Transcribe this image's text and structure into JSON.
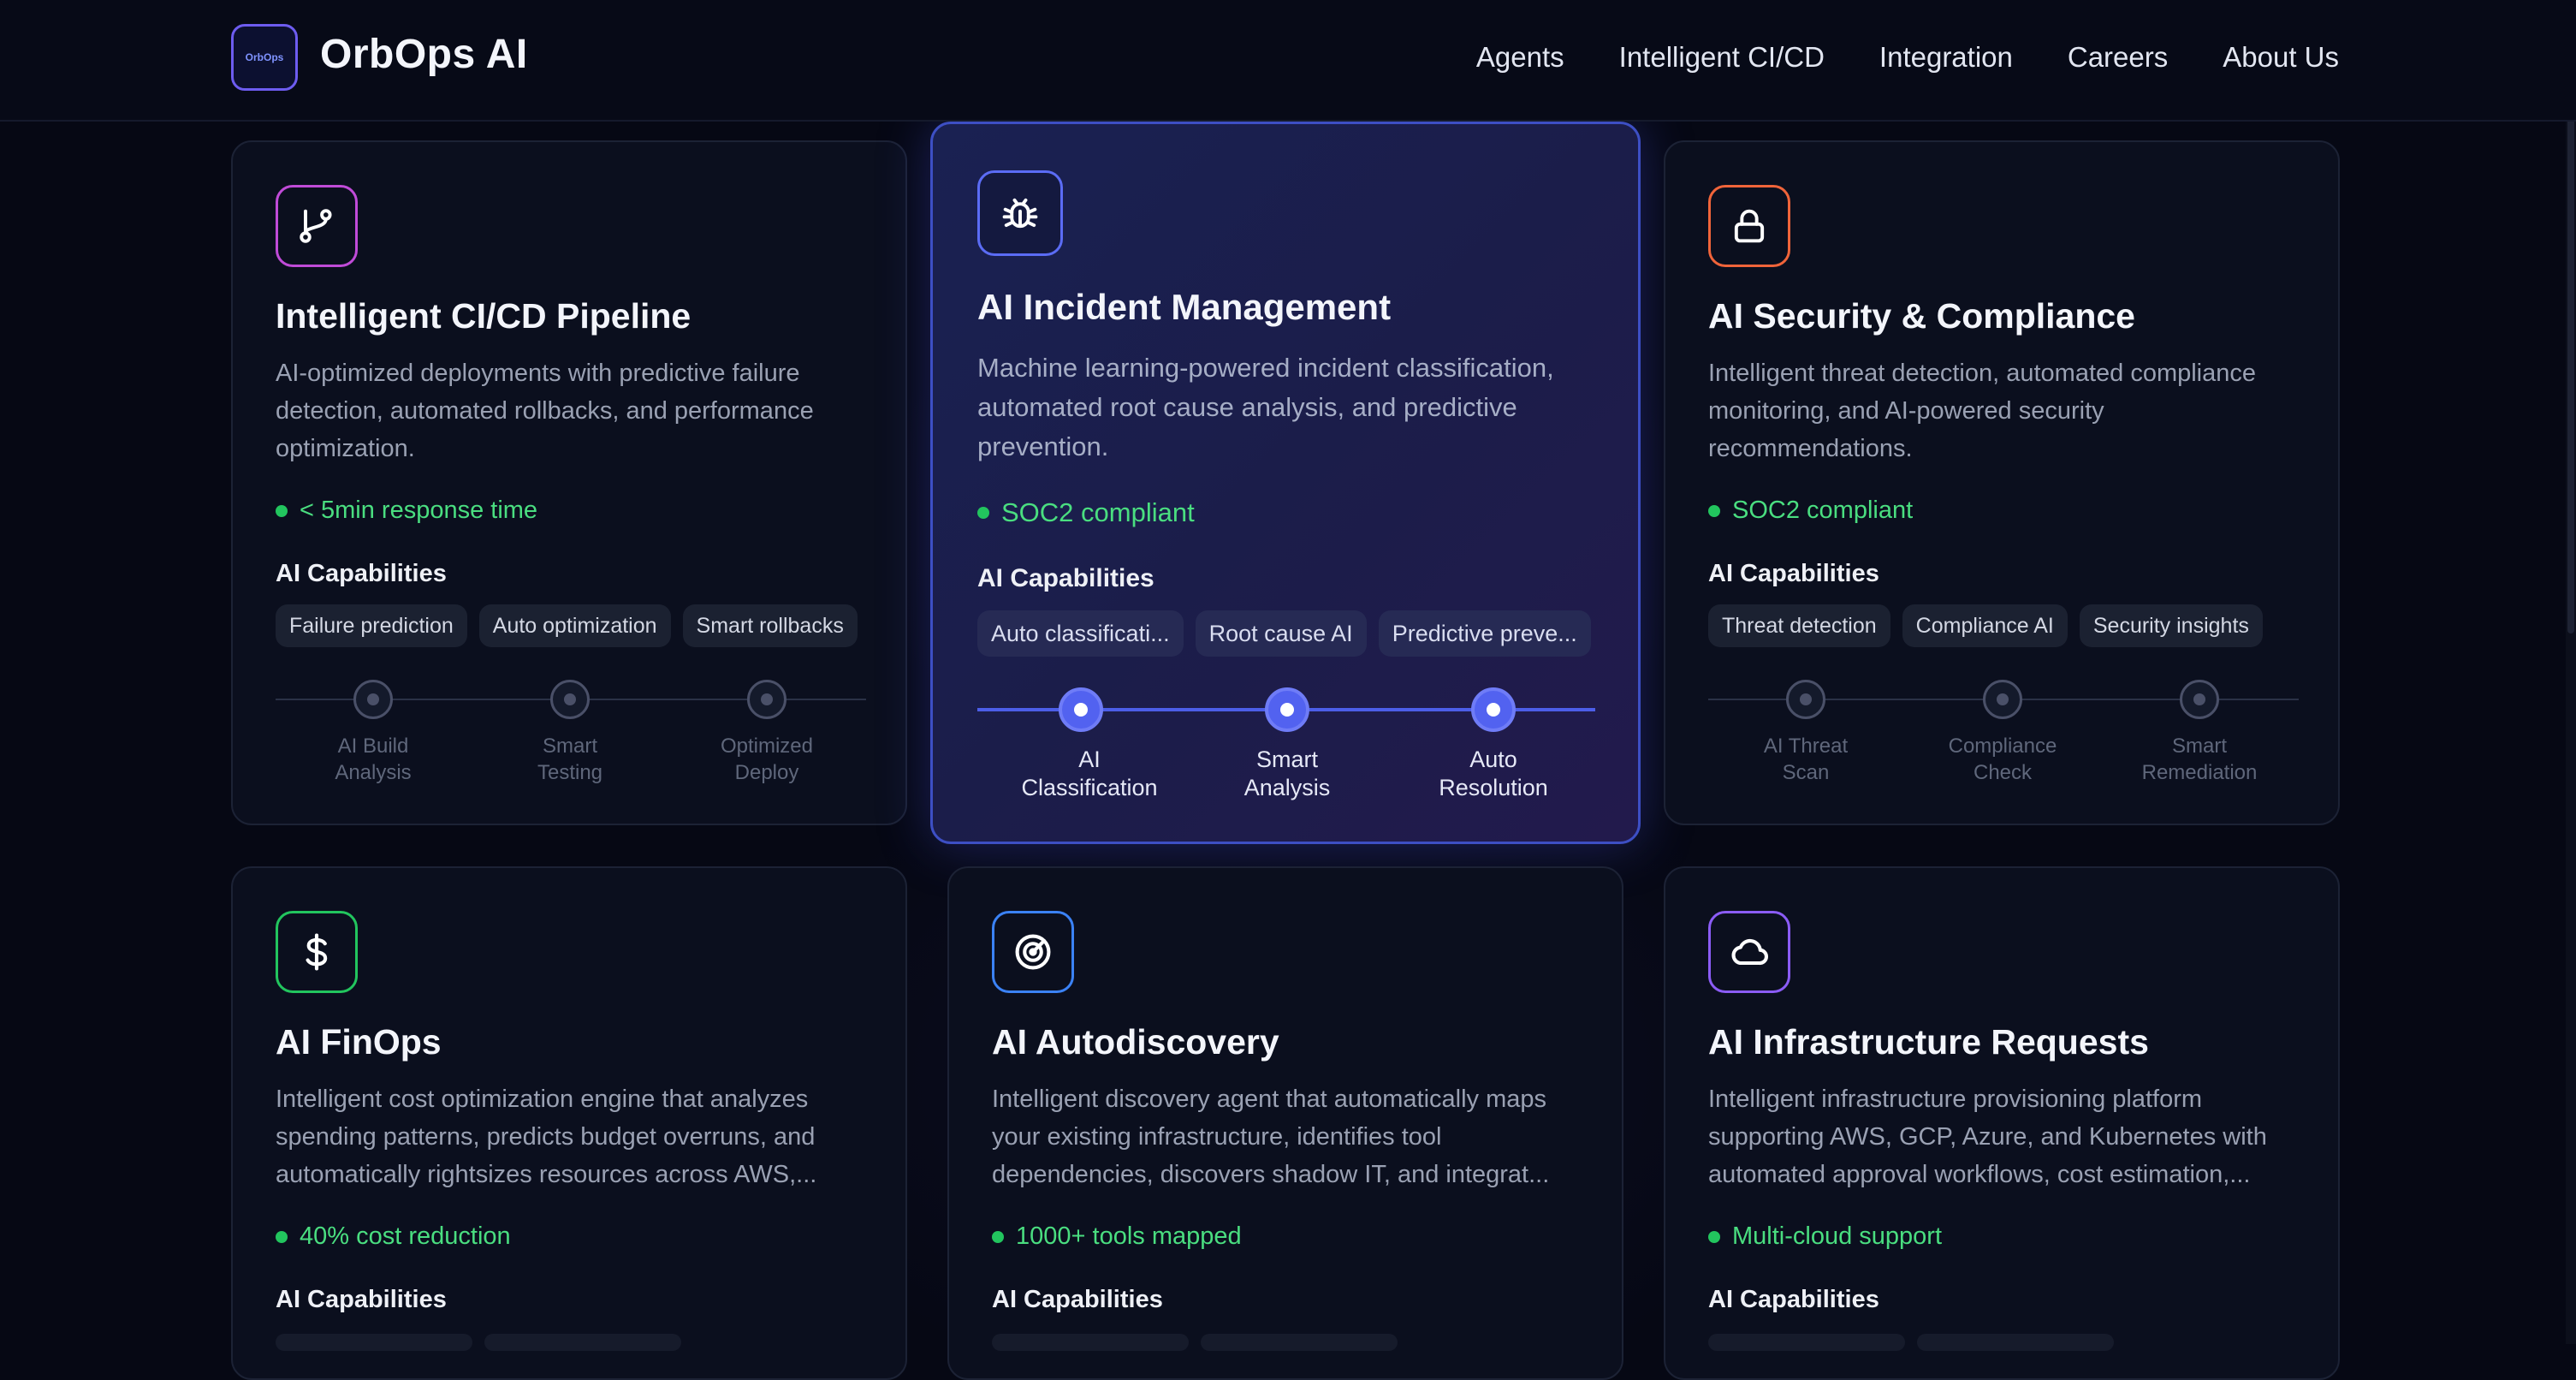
{
  "header": {
    "logo_text": "OrbOps",
    "brand": "OrbOps AI",
    "nav": [
      "Agents",
      "Intelligent CI/CD",
      "Integration",
      "Careers",
      "About Us"
    ]
  },
  "cards": [
    {
      "title": "Intelligent CI/CD Pipeline",
      "desc": "AI-optimized deployments with predictive failure detection, automated rollbacks, and performance optimization.",
      "metric": "< 5min response time",
      "cap_title": "AI Capabilities",
      "tags": [
        "Failure prediction",
        "Auto optimization",
        "Smart rollbacks"
      ],
      "steps": [
        "AI Build\nAnalysis",
        "Smart\nTesting",
        "Optimized\nDeploy"
      ],
      "icon": "git-branch-icon",
      "accent": "#c04bd8"
    },
    {
      "title": "AI Incident Management",
      "desc": "Machine learning-powered incident classification, automated root cause analysis, and predictive prevention.",
      "metric": "SOC2 compliant",
      "cap_title": "AI Capabilities",
      "tags": [
        "Auto classificati...",
        "Root cause AI",
        "Predictive preve..."
      ],
      "steps": [
        "AI\nClassification",
        "Smart\nAnalysis",
        "Auto\nResolution"
      ],
      "icon": "bug-icon",
      "accent": "#5b6cf5"
    },
    {
      "title": "AI Security & Compliance",
      "desc": "Intelligent threat detection, automated compliance monitoring, and AI-powered security recommendations.",
      "metric": "SOC2 compliant",
      "cap_title": "AI Capabilities",
      "tags": [
        "Threat detection",
        "Compliance AI",
        "Security insights"
      ],
      "steps": [
        "AI Threat\nScan",
        "Compliance\nCheck",
        "Smart\nRemediation"
      ],
      "icon": "lock-icon",
      "accent": "#f0643a"
    },
    {
      "title": "AI FinOps",
      "desc": "Intelligent cost optimization engine that analyzes spending patterns, predicts budget overruns, and automatically rightsizes resources across AWS,...",
      "metric": "40% cost reduction",
      "cap_title": "AI Capabilities",
      "icon": "dollar-icon",
      "accent": "#22c55e"
    },
    {
      "title": "AI Autodiscovery",
      "desc": "Intelligent discovery agent that automatically maps your existing infrastructure, identifies tool dependencies, discovers shadow IT, and integrat...",
      "metric": "1000+ tools mapped",
      "cap_title": "AI Capabilities",
      "icon": "radar-icon",
      "accent": "#3b82f6"
    },
    {
      "title": "AI Infrastructure Requests",
      "desc": "Intelligent infrastructure provisioning platform supporting AWS, GCP, Azure, and Kubernetes with automated approval workflows, cost estimation,...",
      "metric": "Multi-cloud support",
      "cap_title": "AI Capabilities",
      "icon": "cloud-icon",
      "accent": "#8b5cf6"
    }
  ]
}
